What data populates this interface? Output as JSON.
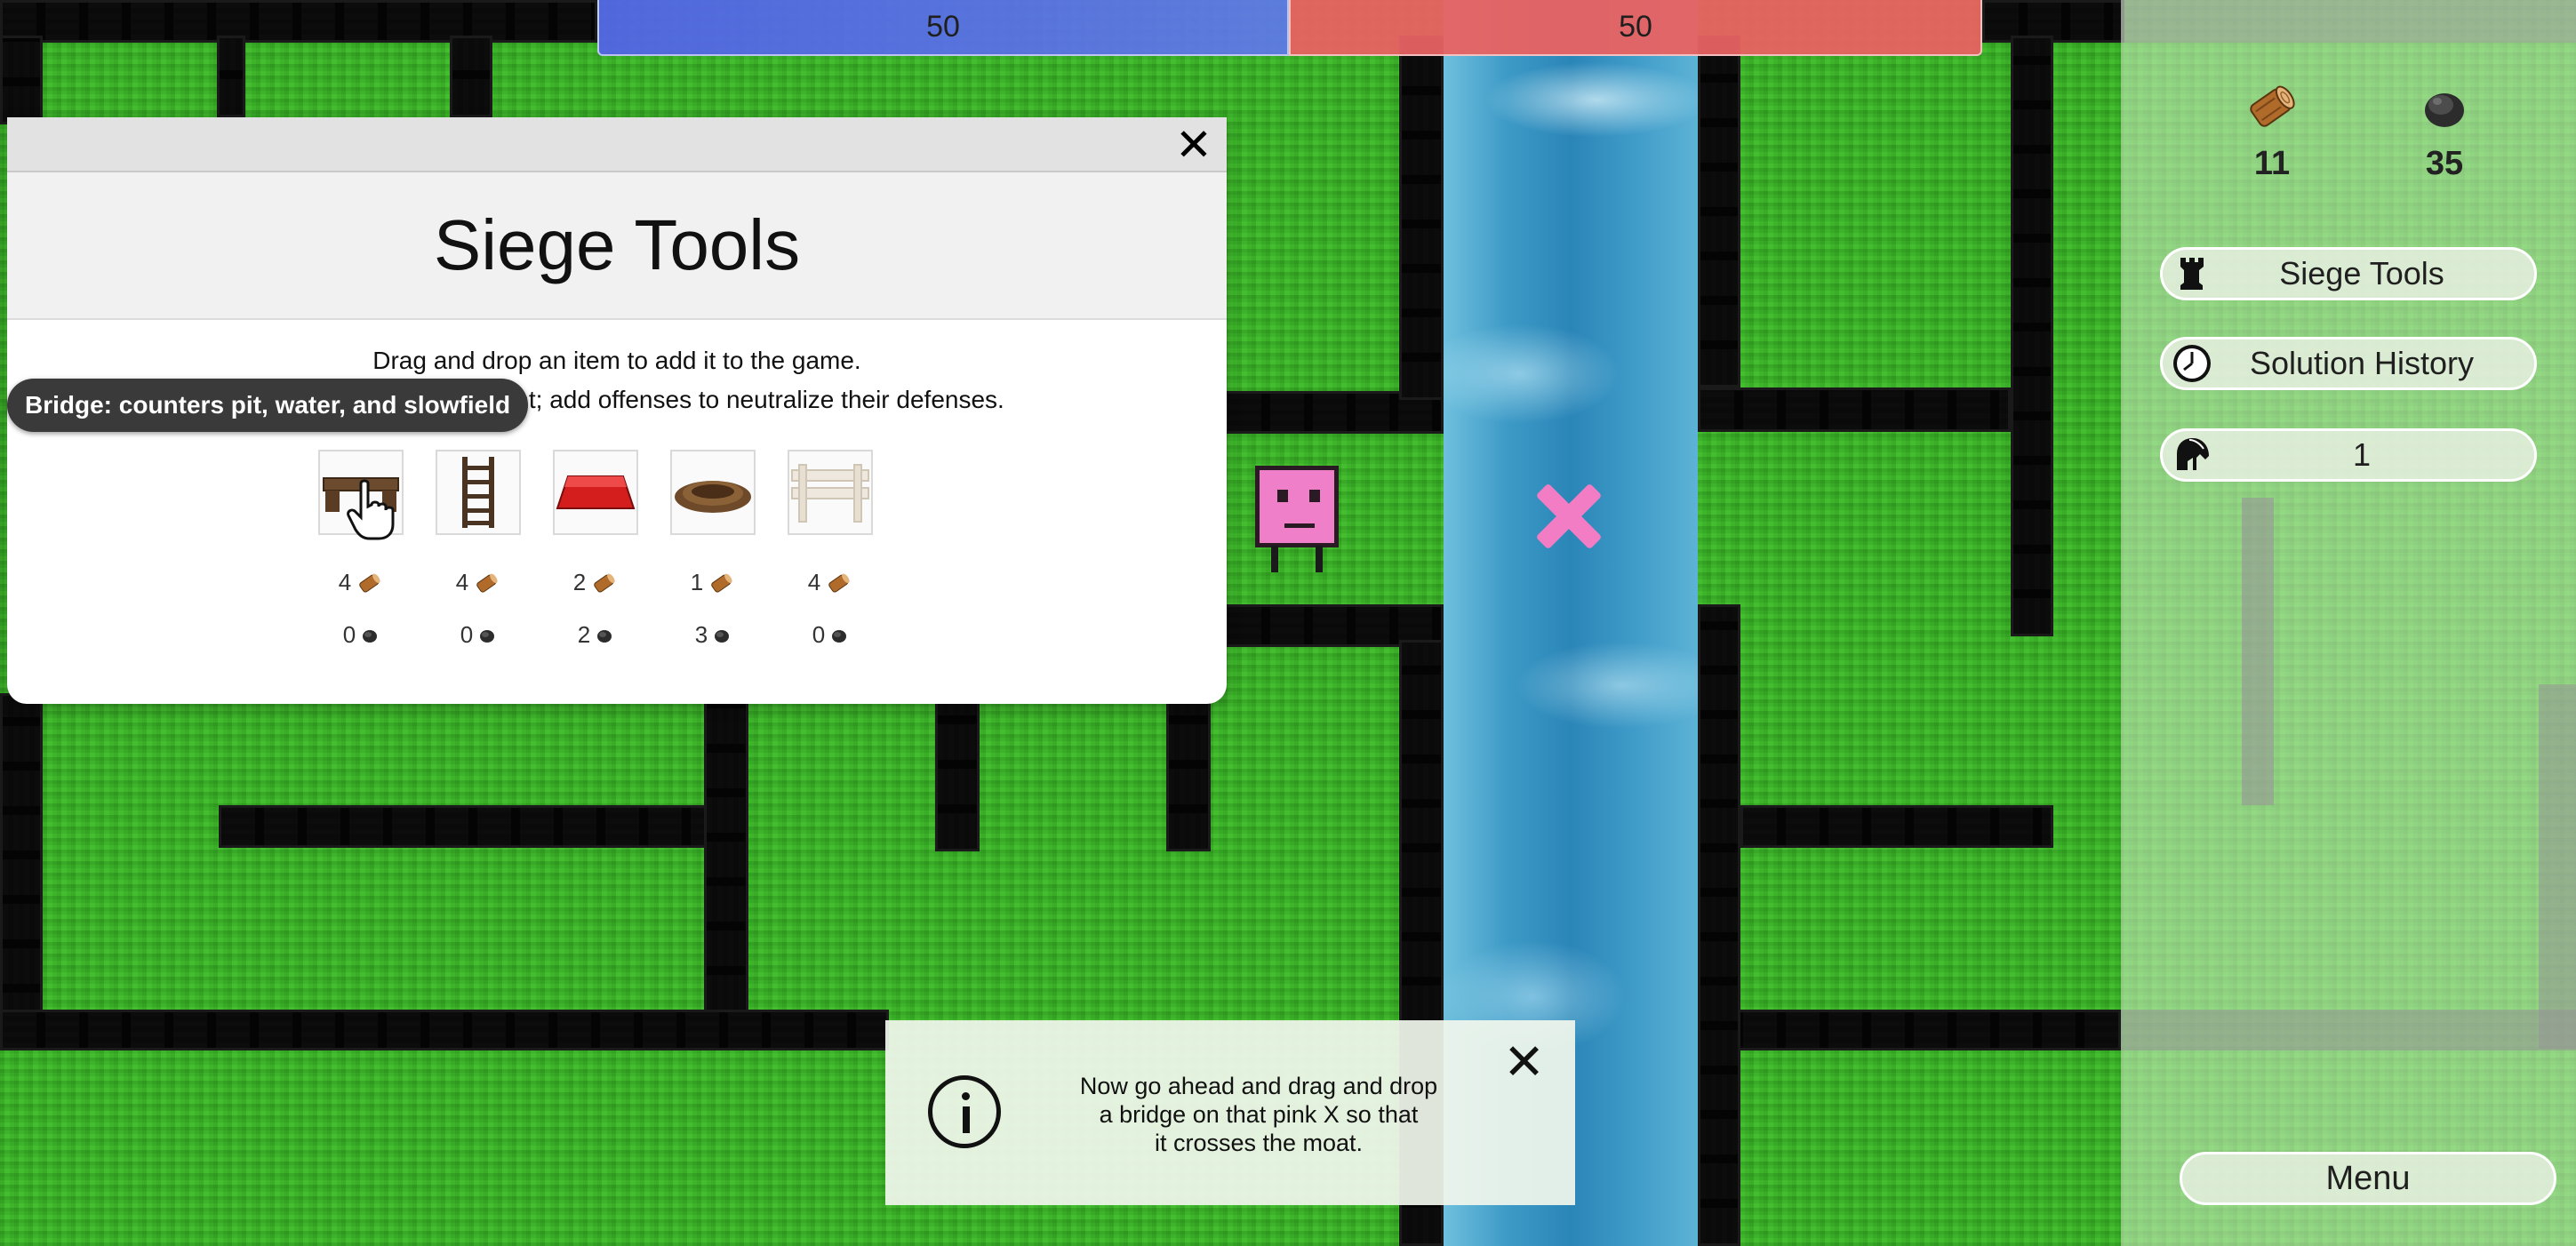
{
  "score": {
    "blue": "50",
    "red": "50"
  },
  "resources": {
    "wood": "11",
    "stone": "35"
  },
  "side_menu": {
    "siege_tools": "Siege Tools",
    "solution_history": "Solution History",
    "attackers": "1",
    "menu": "Menu"
  },
  "modal": {
    "title": "Siege Tools",
    "desc_line1": "Drag and drop an item to add it to the game.",
    "desc_line2": "nent; add offenses to neutralize their defenses.",
    "tooltip": "Bridge: counters pit, water, and slowfield",
    "tools": [
      {
        "name": "bridge",
        "wood": "4",
        "stone": "0"
      },
      {
        "name": "ladder",
        "wood": "4",
        "stone": "0"
      },
      {
        "name": "ram",
        "wood": "2",
        "stone": "2"
      },
      {
        "name": "dirt-pile",
        "wood": "1",
        "stone": "3"
      },
      {
        "name": "fence",
        "wood": "4",
        "stone": "0"
      }
    ]
  },
  "toast": {
    "line1": "Now go ahead and drag and drop",
    "line2": "a bridge on that pink X so that",
    "line3": "it crosses the moat."
  },
  "colors": {
    "grass": "#3cb52a",
    "water": "#2b86b8",
    "team_blue": "#5264e6",
    "team_red": "#e86262",
    "marker_pink": "#f27dc4"
  },
  "icons": [
    "wood-log-icon",
    "stone-icon",
    "rook-icon",
    "clock-icon",
    "helmet-icon",
    "close-icon",
    "info-icon",
    "hand-cursor-icon"
  ]
}
